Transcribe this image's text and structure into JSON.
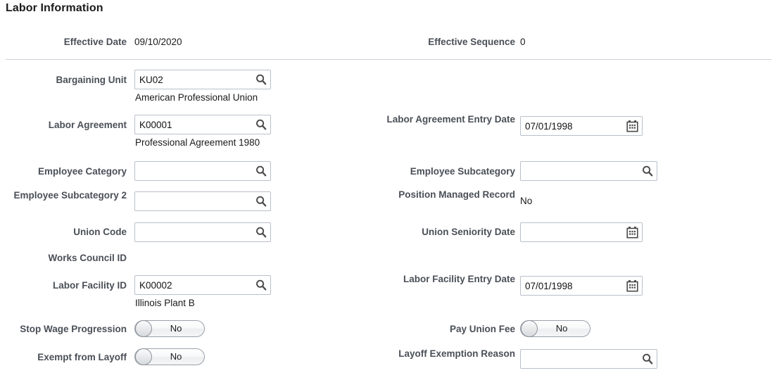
{
  "header": {
    "title": "Labor Information"
  },
  "top_row": {
    "effective_date_label": "Effective Date",
    "effective_date_value": "09/10/2020",
    "effective_sequence_label": "Effective Sequence",
    "effective_sequence_value": "0"
  },
  "left_column": {
    "bargaining_unit": {
      "label": "Bargaining Unit",
      "value": "KU02",
      "description": "American Professional Union",
      "icon": "search-icon"
    },
    "labor_agreement": {
      "label": "Labor Agreement",
      "value": "K00001",
      "description": "Professional Agreement 1980",
      "icon": "search-icon"
    },
    "employee_category": {
      "label": "Employee Category",
      "value": "",
      "icon": "search-icon"
    },
    "employee_subcategory_2": {
      "label": "Employee Subcategory 2",
      "value": "",
      "icon": "search-icon"
    },
    "union_code": {
      "label": "Union Code",
      "value": "",
      "icon": "search-icon"
    },
    "works_council_id": {
      "label": "Works Council ID",
      "value": ""
    },
    "labor_facility_id": {
      "label": "Labor Facility ID",
      "value": "K00002",
      "description": "Illinois Plant B",
      "icon": "search-icon"
    },
    "stop_wage_progression": {
      "label": "Stop Wage Progression",
      "value": "No"
    },
    "exempt_from_layoff": {
      "label": "Exempt from Layoff",
      "value": "No"
    }
  },
  "right_column": {
    "labor_agreement_entry_date": {
      "label": "Labor Agreement Entry Date",
      "value": "07/01/1998",
      "icon": "calendar-icon"
    },
    "employee_subcategory": {
      "label": "Employee Subcategory",
      "value": "",
      "icon": "search-icon"
    },
    "position_managed_record": {
      "label": "Position Managed Record",
      "value": "No"
    },
    "union_seniority_date": {
      "label": "Union Seniority Date",
      "value": "",
      "icon": "calendar-icon"
    },
    "labor_facility_entry_date": {
      "label": "Labor Facility Entry Date",
      "value": "07/01/1998",
      "icon": "calendar-icon"
    },
    "pay_union_fee": {
      "label": "Pay Union Fee",
      "value": "No"
    },
    "layoff_exemption_reason": {
      "label": "Layoff Exemption Reason",
      "value": "",
      "icon": "search-icon"
    }
  },
  "colors": {
    "label": "#4a4f57",
    "text": "#1a1a1a",
    "border": "#b9c0c9",
    "divider": "#ccd1d9"
  }
}
